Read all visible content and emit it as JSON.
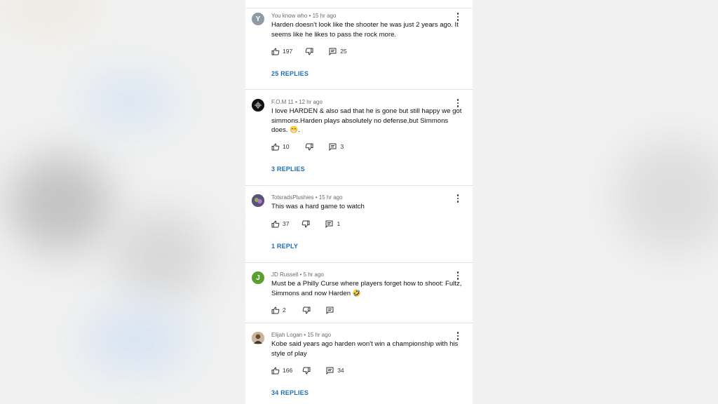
{
  "comments": [
    {
      "author": "You know who",
      "time": "15 hr ago",
      "avatar_letter": "Y",
      "avatar_color": "#8e9aa6",
      "text": "Harden doesn't look like the shooter he was just 2 years ago. It seems like he likes to pass the rock more.",
      "likes": "197",
      "replies_count": "25",
      "view_replies": "25 REPLIES"
    },
    {
      "author": "F.O.M 11",
      "time": "12 hr ago",
      "avatar_letter": "",
      "avatar_color": "#111111",
      "text": "I love HARDEN & also sad that he is gone but still happy we got simmons.Harden plays absolutely no defense,but Simmons does. 😁.",
      "likes": "10",
      "replies_count": "3",
      "view_replies": "3 REPLIES"
    },
    {
      "author": "TotsradsPlushies",
      "time": "15 hr ago",
      "avatar_letter": "",
      "avatar_color": "#6a5a8c",
      "text": "This was a hard game to watch",
      "likes": "37",
      "replies_count": "1",
      "view_replies": "1 REPLY"
    },
    {
      "author": "JD Russell",
      "time": "5 hr ago",
      "avatar_letter": "J",
      "avatar_color": "#5a9e2f",
      "text": "Must be a Philly Curse where players forget how to shoot: Fultz, Simmons and now Harden 🤣",
      "likes": "2"
    },
    {
      "author": "Elijah Logan",
      "time": "15 hr ago",
      "avatar_letter": "",
      "avatar_color": "#a8866a",
      "text": "Kobe said years ago harden won't win a championship with his style of play",
      "likes": "166",
      "replies_count": "34",
      "view_replies": "34 REPLIES"
    }
  ],
  "meta_separator": "•",
  "accent_color": "#1f6fb8"
}
